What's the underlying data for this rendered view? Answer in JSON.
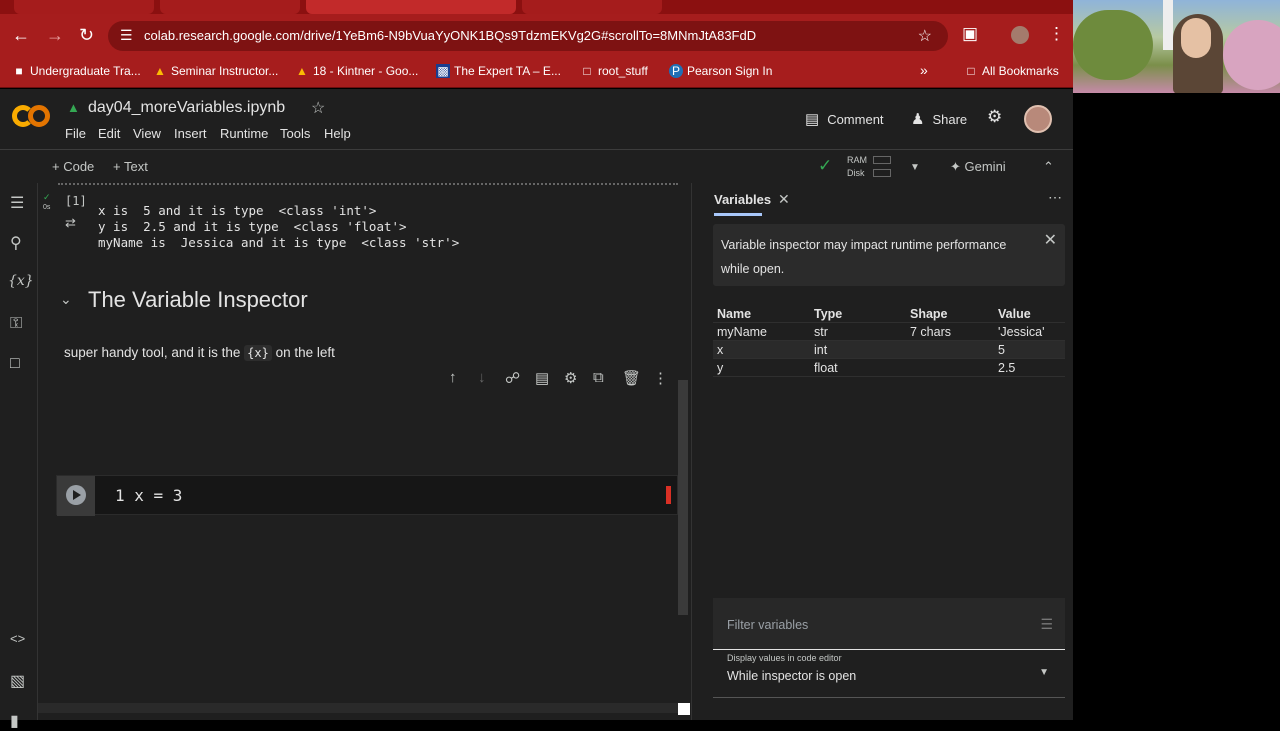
{
  "browser": {
    "url": "colab.research.google.com/drive/1YeBm6-N9bVuaYyONK1BQs9TdzmEKVg2G#scrollTo=8MNmJtA83FdD",
    "bookmarks": [
      {
        "label": "Undergraduate Tra...",
        "icon": "tag-icon"
      },
      {
        "label": "Seminar Instructor...",
        "icon": "drive-icon"
      },
      {
        "label": "18 - Kintner - Goo...",
        "icon": "drive-icon"
      },
      {
        "label": "The Expert TA – E...",
        "icon": "ta-icon"
      },
      {
        "label": "root_stuff",
        "icon": "folder-icon"
      },
      {
        "label": "Pearson Sign In",
        "icon": "pearson-icon"
      }
    ],
    "all_bookmarks": "All Bookmarks"
  },
  "colab": {
    "notebook_title": "day04_moreVariables.ipynb",
    "menu": [
      "File",
      "Edit",
      "View",
      "Insert",
      "Runtime",
      "Tools",
      "Help"
    ],
    "comment_label": "Comment",
    "share_label": "Share",
    "add_code": "+ Code",
    "add_text": "+ Text",
    "ram_label": "RAM",
    "disk_label": "Disk",
    "gemini_label": "Gemini"
  },
  "notebook": {
    "exec_count": "[1]",
    "exec_time": "0s",
    "output_lines": [
      "x is  5 and it is type  <class 'int'>",
      "y is  2.5 and it is type  <class 'float'>",
      "myName is  Jessica and it is type  <class 'str'>"
    ],
    "section_heading": "The Variable Inspector",
    "paragraph_before": "super handy tool, and it is the",
    "paragraph_code": "{x}",
    "paragraph_after": "on the left",
    "cell_code": "1 x = 3"
  },
  "variables_panel": {
    "title": "Variables",
    "notice": "Variable inspector may impact runtime performance while open.",
    "columns": [
      "Name",
      "Type",
      "Shape",
      "Value"
    ],
    "rows": [
      {
        "name": "myName",
        "type": "str",
        "shape": "7 chars",
        "value": "'Jessica'"
      },
      {
        "name": "x",
        "type": "int",
        "shape": "",
        "value": "5"
      },
      {
        "name": "y",
        "type": "float",
        "shape": "",
        "value": "2.5"
      }
    ],
    "filter_placeholder": "Filter variables",
    "display_label": "Display values in code editor",
    "display_value": "While inspector is open"
  }
}
